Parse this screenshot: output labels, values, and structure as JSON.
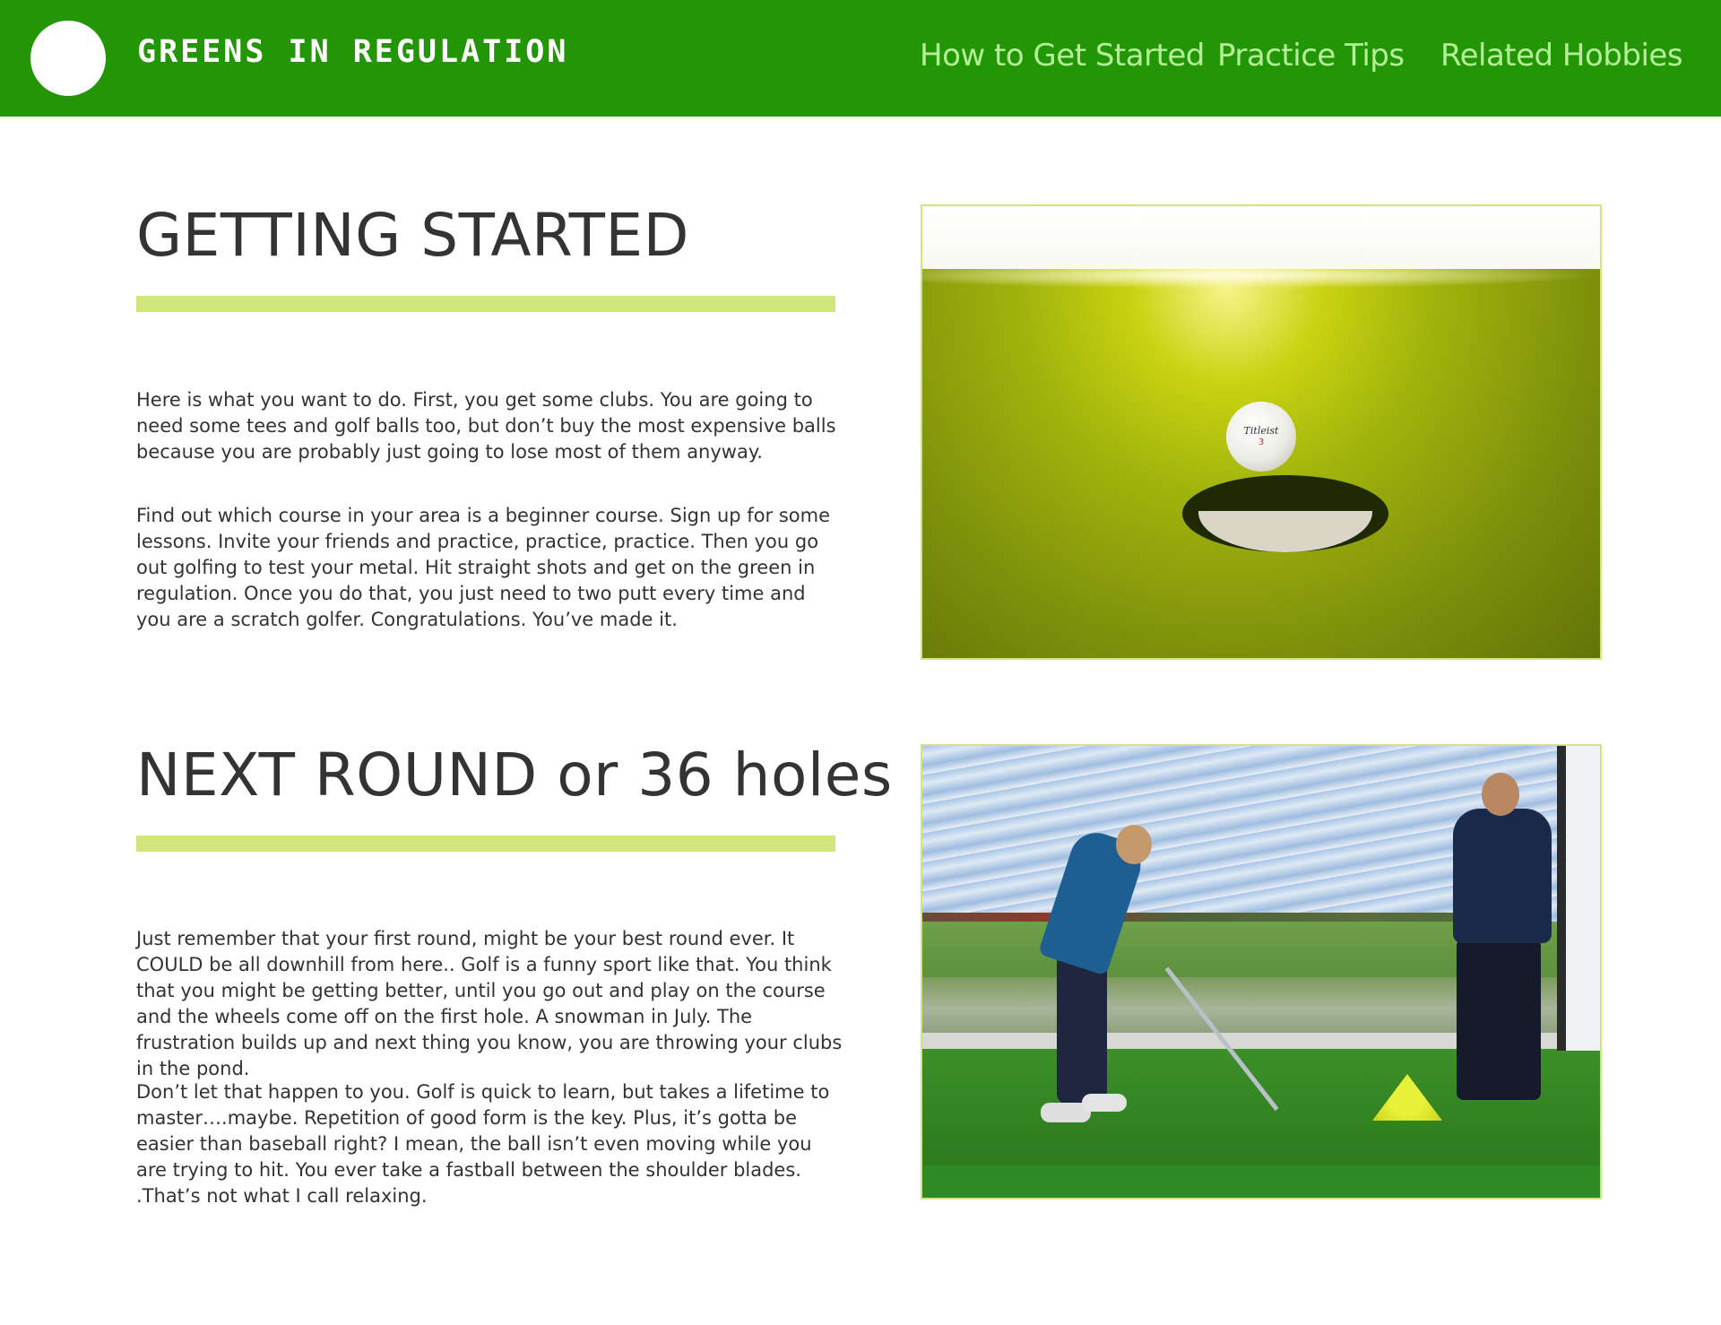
{
  "header": {
    "site_title": "GREENS IN REGULATION",
    "nav": [
      {
        "label": "How to Get Started"
      },
      {
        "label": "Practice Tips"
      },
      {
        "label": "Related Hobbies"
      }
    ]
  },
  "sections": [
    {
      "heading": "GETTING STARTED",
      "paragraphs": [
        "Here is what you want to do. First, you get some clubs. You are going to need some tees and golf balls too, but don’t buy the most expensive balls because you are probably just going to lose most of them anyway.",
        "Find out which course in your area is a beginner course. Sign up for some lessons. Invite your friends and practice, practice, practice. Then you go out golfing to test your metal. Hit straight shots and get on the green in regulation. Once you do that, you just need to two putt every time and you are a scratch golfer. Congratulations. You’ve made it."
      ],
      "image": {
        "ball_brand": "Titleist",
        "ball_number": "3"
      }
    },
    {
      "heading": "NEXT ROUND or 36 holes",
      "paragraphs": [
        "Just remember that your first round, might be your best round ever. It COULD be all downhill from here.. Golf is a funny sport like that. You think that you might be getting better, until you go out and play on the course and the wheels come off on the first hole. A snowman in July. The frustration builds up and next thing you know, you are throwing your clubs in the pond.",
        "Don’t let that happen to you. Golf is quick to learn, but takes a lifetime to master….maybe. Repetition of good form is the key. Plus, it’s gotta be easier than baseball right? I mean, the ball isn’t even moving while you are trying to hit. You ever take a fastball between the shoulder blades. .That’s not what I call relaxing."
      ]
    }
  ],
  "colors": {
    "header_bg": "#229604",
    "nav_text": "#b6ef9a",
    "accent_bar": "#d0e57b",
    "body_text": "#333333"
  },
  "icons": {
    "logo": "white-circle-logo-icon"
  }
}
